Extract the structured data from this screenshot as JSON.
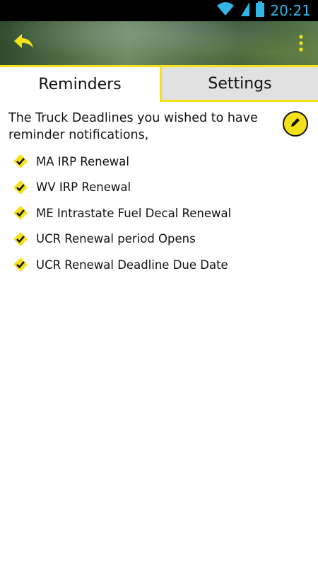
{
  "status_bar": {
    "time": "20:21"
  },
  "action_bar": {
    "back_icon": "back-arrow-icon",
    "overflow_icon": "overflow-menu-icon"
  },
  "tabs": [
    {
      "label": "Reminders",
      "selected": true
    },
    {
      "label": "Settings",
      "selected": false
    }
  ],
  "main": {
    "intro_text": "The Truck Deadlines you wished to have reminder notifications,",
    "edit_icon": "pencil-icon",
    "reminders": [
      {
        "label": "MA IRP Renewal"
      },
      {
        "label": "WV IRP Renewal"
      },
      {
        "label": "ME Intrastate Fuel Decal Renewal"
      },
      {
        "label": "UCR Renewal period Opens"
      },
      {
        "label": "UCR Renewal Deadline Due Date"
      }
    ]
  },
  "colors": {
    "accent": "#f5e11a",
    "status_time": "#33b5e5",
    "tab_inactive_bg": "#e1e1e1"
  }
}
